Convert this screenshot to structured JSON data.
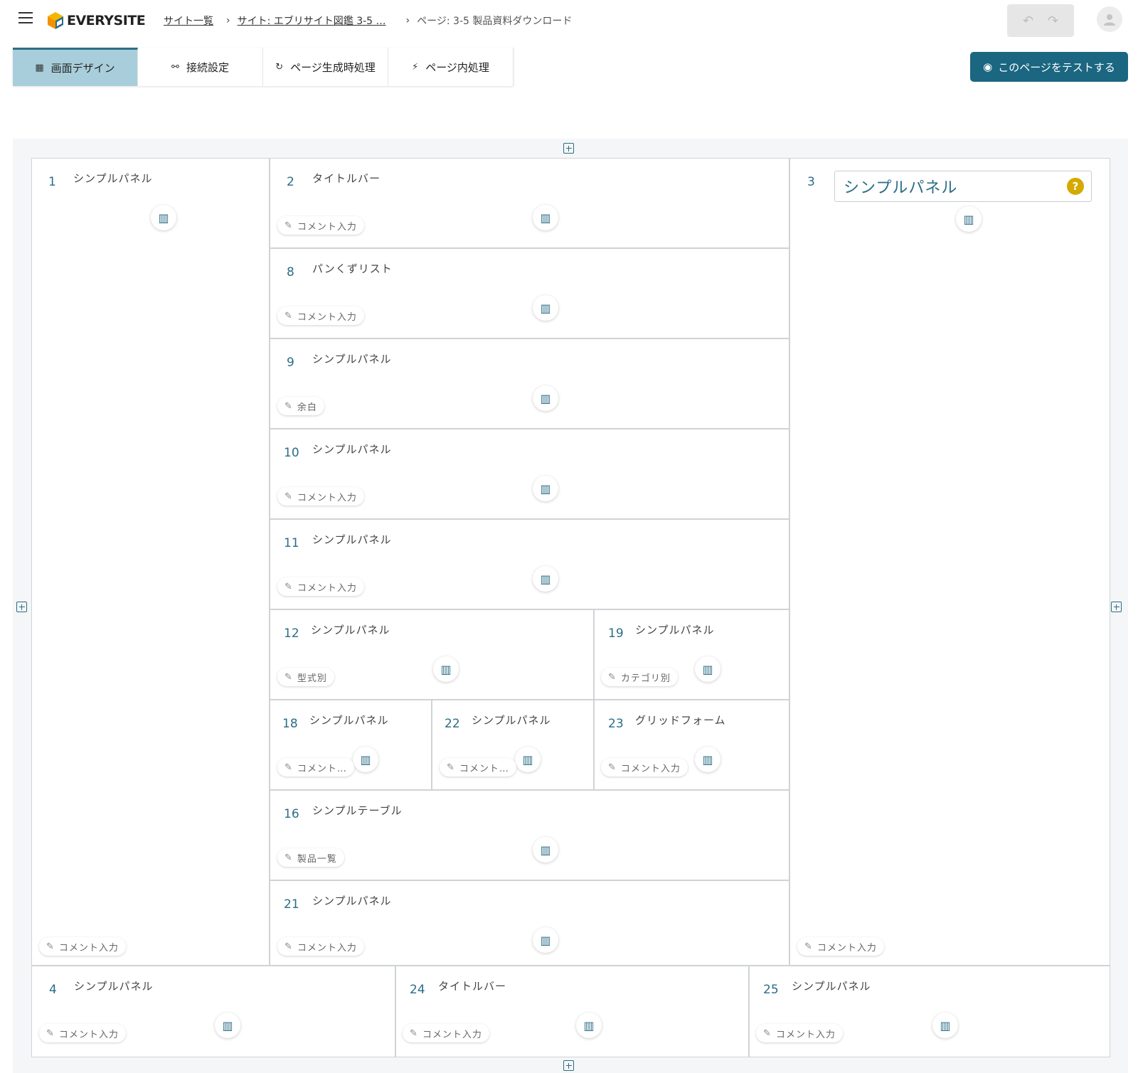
{
  "header": {
    "logo_text": "EVERYSITE",
    "breadcrumb": {
      "site_list": "サイト一覧",
      "site": "サイト: エブリサイト図鑑 3-5 …",
      "page": "ページ: 3-5 製品資料ダウンロード"
    }
  },
  "tabs": [
    {
      "label": "画面デザイン",
      "icon": "layout-icon"
    },
    {
      "label": "接続設定",
      "icon": "connection-icon"
    },
    {
      "label": "ページ生成時処理",
      "icon": "refresh-icon"
    },
    {
      "label": "ページ内処理",
      "icon": "run-icon"
    }
  ],
  "test_button": "このページをテストする",
  "title_input_value": "シンプルパネル",
  "panels": {
    "p1": {
      "num": "1",
      "name": "シンプルパネル",
      "comment": "コメント入力"
    },
    "p2": {
      "num": "2",
      "name": "タイトルバー",
      "comment": "コメント入力"
    },
    "p8": {
      "num": "8",
      "name": "パンくずリスト",
      "comment": "コメント入力"
    },
    "p9": {
      "num": "9",
      "name": "シンプルパネル",
      "comment": "余白"
    },
    "p10": {
      "num": "10",
      "name": "シンプルパネル",
      "comment": "コメント入力"
    },
    "p11": {
      "num": "11",
      "name": "シンプルパネル",
      "comment": "コメント入力"
    },
    "p12": {
      "num": "12",
      "name": "シンプルパネル",
      "comment": "型式別"
    },
    "p19": {
      "num": "19",
      "name": "シンプルパネル",
      "comment": "カテゴリ別"
    },
    "p18": {
      "num": "18",
      "name": "シンプルパネル",
      "comment": "コメント…"
    },
    "p22": {
      "num": "22",
      "name": "シンプルパネル",
      "comment": "コメント…"
    },
    "p23": {
      "num": "23",
      "name": "グリッドフォーム",
      "comment": "コメント入力"
    },
    "p16": {
      "num": "16",
      "name": "シンプルテーブル",
      "comment": "製品一覧"
    },
    "p21": {
      "num": "21",
      "name": "シンプルパネル",
      "comment": "コメント入力"
    },
    "p3": {
      "num": "3",
      "name": "",
      "comment": "コメント入力"
    },
    "p4": {
      "num": "4",
      "name": "シンプルパネル",
      "comment": "コメント入力"
    },
    "p24": {
      "num": "24",
      "name": "タイトルバー",
      "comment": "コメント入力"
    },
    "p25": {
      "num": "25",
      "name": "シンプルパネル",
      "comment": "コメント入力"
    }
  }
}
